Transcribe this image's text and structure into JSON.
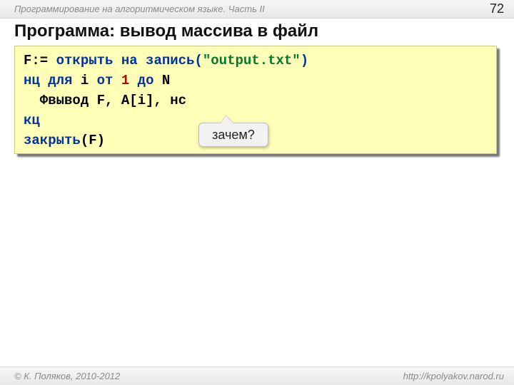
{
  "header": {
    "series_title": "Программирование на алгоритмическом языке. Часть II",
    "page_number": "72"
  },
  "title": "Программа: вывод массива в файл",
  "code": {
    "l1_var": "F",
    "l1_assign": ":=",
    "l1_kw_open": "открыть на запись",
    "l1_lp": "(",
    "l1_str": "\"output.txt\"",
    "l1_rp": ")",
    "l2_kw_nc": "нц для",
    "l2_iter": " i ",
    "l2_kw_ot": "от",
    "l2_one": " 1 ",
    "l2_kw_do": "до",
    "l2_N": " N",
    "l3_body": "  Фвывод F, A[i], нс",
    "l4_kc": "кц",
    "l5_close": "закрыть",
    "l5_args": "(F)"
  },
  "callout": {
    "text": "зачем?"
  },
  "footer": {
    "copyright": "© К. Поляков, 2010-2012",
    "url": "http://kpolyakov.narod.ru"
  }
}
